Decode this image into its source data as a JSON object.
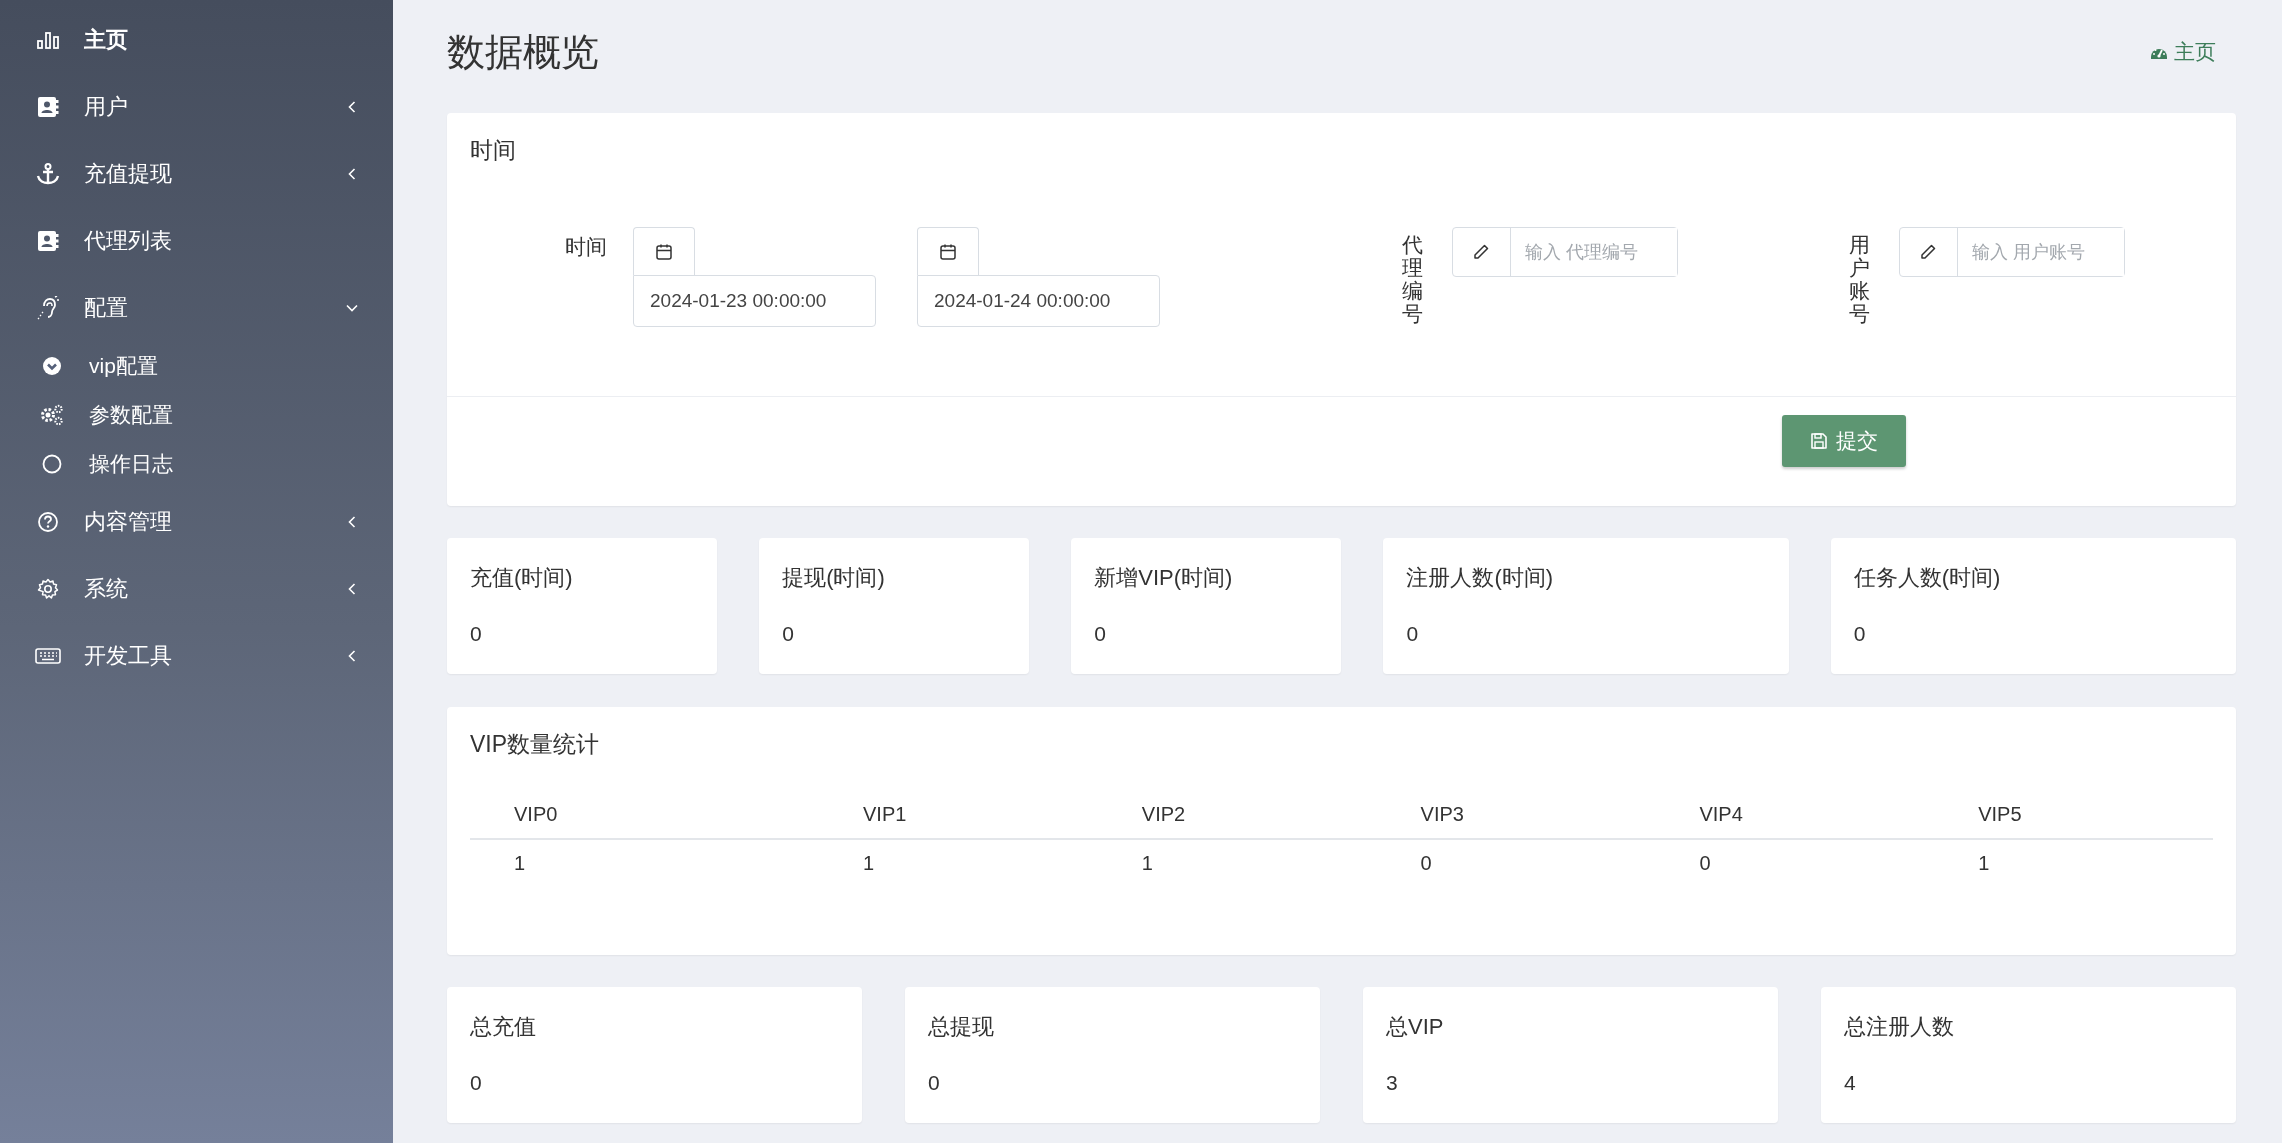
{
  "sidebar": {
    "items": [
      {
        "label": "主页",
        "kind": "link",
        "selected": true
      },
      {
        "label": "用户",
        "kind": "menu",
        "selected": false,
        "expanded": false
      },
      {
        "label": "充值提现",
        "kind": "menu",
        "selected": false,
        "expanded": false
      },
      {
        "label": "代理列表",
        "kind": "link",
        "selected": false
      },
      {
        "label": "配置",
        "kind": "menu",
        "selected": false,
        "expanded": true,
        "children": [
          {
            "label": "vip配置"
          },
          {
            "label": "参数配置"
          },
          {
            "label": "操作日志"
          }
        ]
      },
      {
        "label": "内容管理",
        "kind": "menu",
        "selected": false,
        "expanded": false
      },
      {
        "label": "系统",
        "kind": "menu",
        "selected": false,
        "expanded": false
      },
      {
        "label": "开发工具",
        "kind": "menu",
        "selected": false,
        "expanded": false
      }
    ]
  },
  "page": {
    "title": "数据概览",
    "breadcrumb": "主页"
  },
  "filter": {
    "title": "时间",
    "fields": [
      {
        "kind": "daterange",
        "label": "时间",
        "values": [
          "2024-01-23 00:00:00",
          "2024-01-24 00:00:00"
        ]
      },
      {
        "kind": "text",
        "label": "代理编号",
        "placeholder": "输入 代理编号"
      },
      {
        "kind": "text",
        "label": "用户账号",
        "placeholder": "输入 用户账号"
      }
    ],
    "submit": "提交"
  },
  "period_stats": [
    {
      "label": "充值(时间)",
      "value": "0"
    },
    {
      "label": "提现(时间)",
      "value": "0"
    },
    {
      "label": "新增VIP(时间)",
      "value": "0"
    },
    {
      "label": "注册人数(时间)",
      "value": "0"
    },
    {
      "label": "任务人数(时间)",
      "value": "0"
    }
  ],
  "vip_table": {
    "title": "VIP数量统计",
    "columns": [
      "VIP0",
      "VIP1",
      "VIP2",
      "VIP3",
      "VIP4",
      "VIP5"
    ],
    "rows": [
      [
        "1",
        "1",
        "1",
        "0",
        "0",
        "1"
      ]
    ]
  },
  "totals": [
    {
      "label": "总充值",
      "value": "0"
    },
    {
      "label": "总提现",
      "value": "0"
    },
    {
      "label": "总VIP",
      "value": "3"
    },
    {
      "label": "总注册人数",
      "value": "4"
    }
  ]
}
